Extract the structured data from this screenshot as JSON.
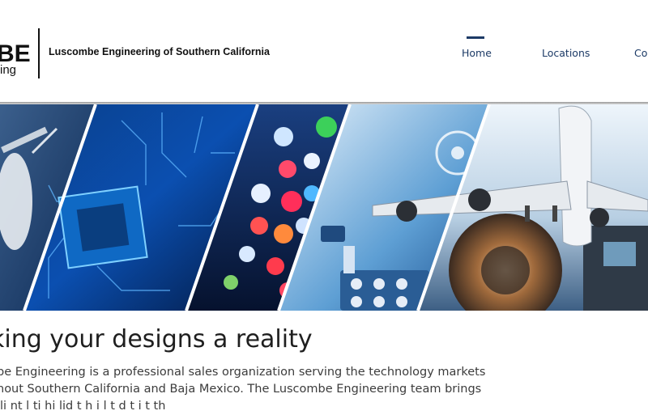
{
  "header": {
    "logo_text": "BE",
    "logo_subtext": "ing",
    "company_name": "Luscombe Engineering of Southern California"
  },
  "nav": {
    "items": [
      {
        "label": "Home",
        "active": true
      },
      {
        "label": "Locations",
        "active": false
      },
      {
        "label": "Co",
        "active": false
      }
    ]
  },
  "hero": {
    "panels": [
      "satellite",
      "circuit-board-chip",
      "colored-leds",
      "medical-device-keypad",
      "airplane-jet-engine"
    ]
  },
  "main": {
    "headline": "king your designs a reality",
    "paragraph_lines": [
      "be Engineering is a professional sales organization serving the technology markets",
      "hout Southern California and Baja Mexico. The Luscombe Engineering team brings",
      "lli nt l ti hi lid t h i l t d t i t th"
    ]
  },
  "colors": {
    "nav_text": "#1c3a66",
    "nav_indicator": "#1c3a66",
    "headline": "#1f1f1f",
    "body_text": "#3c3c3c"
  }
}
